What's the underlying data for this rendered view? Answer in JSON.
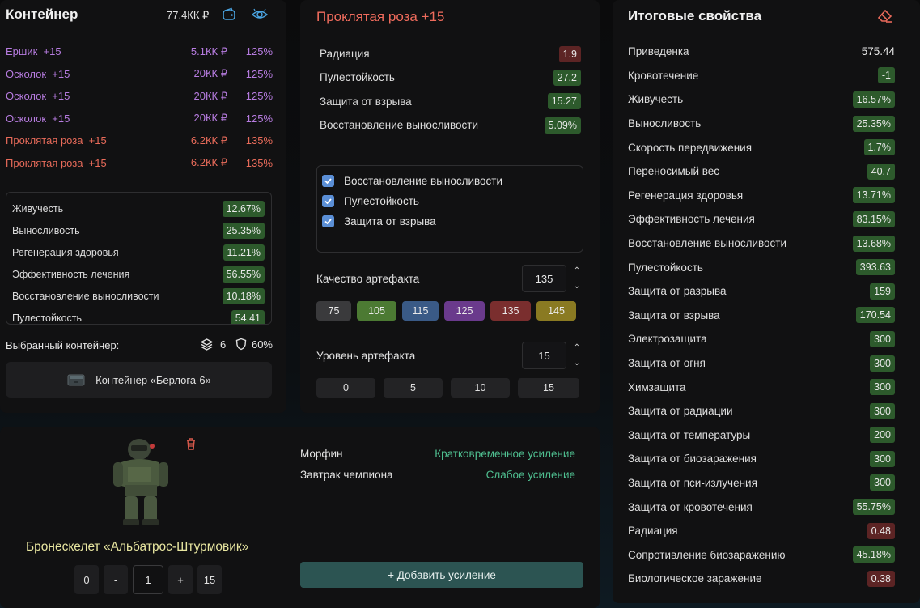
{
  "container": {
    "title": "Контейнер",
    "money": "77.4КК ₽",
    "artifacts": [
      {
        "name": "Ершик",
        "level": "+15",
        "price": "5.1КК ₽",
        "percent": "125%",
        "color": "purple"
      },
      {
        "name": "Осколок",
        "level": "+15",
        "price": "20КК ₽",
        "percent": "125%",
        "color": "purple"
      },
      {
        "name": "Осколок",
        "level": "+15",
        "price": "20КК ₽",
        "percent": "125%",
        "color": "purple"
      },
      {
        "name": "Осколок",
        "level": "+15",
        "price": "20КК ₽",
        "percent": "125%",
        "color": "purple"
      },
      {
        "name": "Проклятая роза",
        "level": "+15",
        "price": "6.2КК ₽",
        "percent": "135%",
        "color": "red"
      },
      {
        "name": "Проклятая роза",
        "level": "+15",
        "price": "6.2КК ₽",
        "percent": "135%",
        "color": "red"
      }
    ],
    "stats": [
      {
        "label": "Живучесть",
        "value": "12.67%"
      },
      {
        "label": "Выносливость",
        "value": "25.35%"
      },
      {
        "label": "Регенерация здоровья",
        "value": "11.21%"
      },
      {
        "label": "Эффективность лечения",
        "value": "56.55%"
      },
      {
        "label": "Восстановление выносливости",
        "value": "10.18%"
      },
      {
        "label": "Пулестойкость",
        "value": "54.41"
      }
    ],
    "selected_label": "Выбранный контейнер:",
    "slots": "6",
    "protection": "60%",
    "container_button": "Контейнер «Берлога-6»"
  },
  "artifact": {
    "title": "Проклятая роза +15",
    "properties": [
      {
        "label": "Радиация",
        "value": "1.9",
        "kind": "r"
      },
      {
        "label": "Пулестойкость",
        "value": "27.2",
        "kind": "g"
      },
      {
        "label": "Защита от взрыва",
        "value": "15.27",
        "kind": "g"
      },
      {
        "label": "Восстановление выносливости",
        "value": "5.09%",
        "kind": "g"
      }
    ],
    "checks": [
      "Восстановление выносливости",
      "Пулестойкость",
      "Защита от взрыва"
    ],
    "quality_label": "Качество артефакта",
    "quality_value": "135",
    "quality_chips": [
      {
        "label": "75",
        "color": "#3a3a3c"
      },
      {
        "label": "105",
        "color": "#4c7a33"
      },
      {
        "label": "115",
        "color": "#3a5a86"
      },
      {
        "label": "125",
        "color": "#6a3a8c"
      },
      {
        "label": "135",
        "color": "#7a2e2e"
      },
      {
        "label": "145",
        "color": "#8a7a22"
      }
    ],
    "level_label": "Уровень артефакта",
    "level_value": "15",
    "level_chips": [
      "0",
      "5",
      "10",
      "15"
    ]
  },
  "totals": {
    "title": "Итоговые свойства",
    "rows": [
      {
        "label": "Приведенка",
        "value": "575.44",
        "kind": "plain"
      },
      {
        "label": "Кровотечение",
        "value": "-1",
        "kind": "g"
      },
      {
        "label": "Живучесть",
        "value": "16.57%",
        "kind": "g"
      },
      {
        "label": "Выносливость",
        "value": "25.35%",
        "kind": "g"
      },
      {
        "label": "Скорость передвижения",
        "value": "1.7%",
        "kind": "g"
      },
      {
        "label": "Переносимый вес",
        "value": "40.7",
        "kind": "g"
      },
      {
        "label": "Регенерация здоровья",
        "value": "13.71%",
        "kind": "g"
      },
      {
        "label": "Эффективность лечения",
        "value": "83.15%",
        "kind": "g"
      },
      {
        "label": "Восстановление выносливости",
        "value": "13.68%",
        "kind": "g"
      },
      {
        "label": "Пулестойкость",
        "value": "393.63",
        "kind": "g"
      },
      {
        "label": "Защита от разрыва",
        "value": "159",
        "kind": "g"
      },
      {
        "label": "Защита от взрыва",
        "value": "170.54",
        "kind": "g"
      },
      {
        "label": "Электрозащита",
        "value": "300",
        "kind": "g"
      },
      {
        "label": "Защита от огня",
        "value": "300",
        "kind": "g"
      },
      {
        "label": "Химзащита",
        "value": "300",
        "kind": "g"
      },
      {
        "label": "Защита от радиации",
        "value": "300",
        "kind": "g"
      },
      {
        "label": "Защита от температуры",
        "value": "200",
        "kind": "g"
      },
      {
        "label": "Защита от биозаражения",
        "value": "300",
        "kind": "g"
      },
      {
        "label": "Защита от пси-излучения",
        "value": "300",
        "kind": "g"
      },
      {
        "label": "Защита от кровотечения",
        "value": "55.75%",
        "kind": "g"
      },
      {
        "label": "Радиация",
        "value": "0.48",
        "kind": "r"
      },
      {
        "label": "Сопротивление биозаражению",
        "value": "45.18%",
        "kind": "g"
      },
      {
        "label": "Биологическое заражение",
        "value": "0.38",
        "kind": "r"
      }
    ]
  },
  "armor": {
    "name": "Бронескелет «Альбатрос-Штурмовик»",
    "min_label": "0",
    "minus_label": "-",
    "level_value": "1",
    "plus_label": "+",
    "max_label": "15",
    "boosts": [
      {
        "name": "Морфин",
        "effect": "Кратковременное усиление"
      },
      {
        "name": "Завтрак чемпиона",
        "effect": "Слабое усиление"
      }
    ],
    "add_button": "+ Добавить усиление"
  }
}
